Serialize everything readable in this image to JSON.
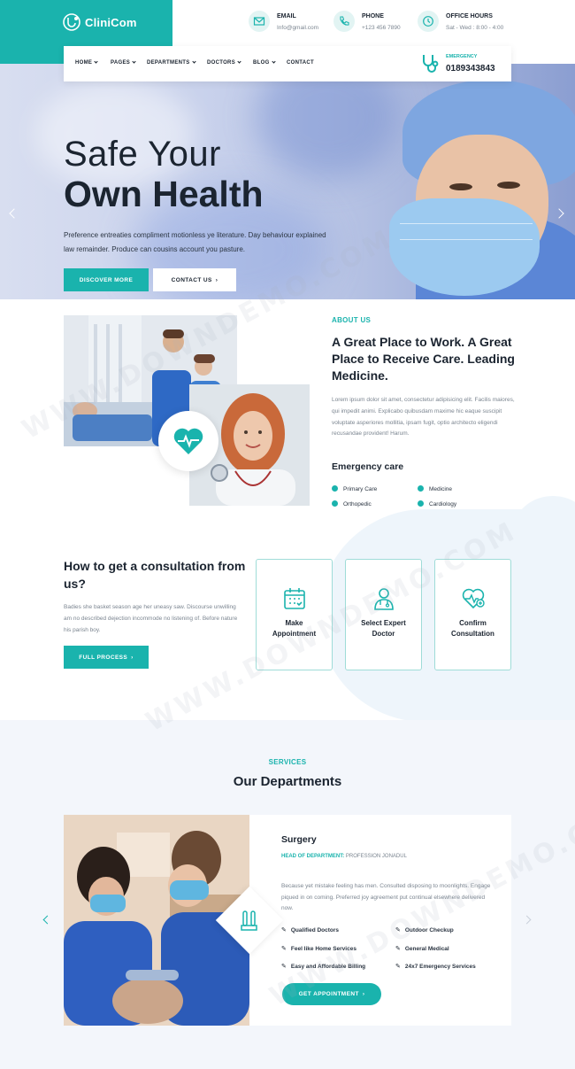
{
  "brand": {
    "name": "CliniCom",
    "accent": "#1ab3ad",
    "dark": "#1b2430"
  },
  "header_info": [
    {
      "title": "EMAIL",
      "value": "Info@gmail.com",
      "icon": "mail-icon"
    },
    {
      "title": "PHONE",
      "value": "+123 456 7890",
      "icon": "phone-icon"
    },
    {
      "title": "OFFICE HOURS",
      "value": "Sat - Wed : 8:00 - 4:00",
      "icon": "clock-icon"
    }
  ],
  "nav": {
    "items": [
      "HOME",
      "PAGES",
      "DEPARTMENTS",
      "DOCTORS",
      "BLOG",
      "CONTACT"
    ],
    "emergency_label": "EMERGENCY",
    "emergency_phone": "0189343843"
  },
  "hero": {
    "title_line1": "Safe Your",
    "title_line2": "Own Health",
    "text": "Preference entreaties compliment motionless ye literature. Day behaviour explained law remainder. Produce can cousins account you pasture.",
    "btn_primary": "DISCOVER MORE",
    "btn_secondary": "CONTACT US"
  },
  "about": {
    "label": "ABOUT US",
    "heading": "A Great Place to Work. A Great Place to Receive Care. Leading Medicine.",
    "text": "Lorem ipsum dolor sit amet, consectetur adipisicing elit. Facilis maiores, qui impedit animi. Explicabo quibusdam maxime hic eaque suscipit voluptate asperiores mollitia, ipsam fugit, optio architecto eligendi recusandae provident! Harum.",
    "emergency_title": "Emergency care",
    "checks": [
      "Primary Care",
      "Medicine",
      "Orthopedic",
      "Cardiology"
    ]
  },
  "consult": {
    "heading": "How to get a consultation from us?",
    "text": "Badies she basket season age her uneasy saw. Discourse unwilling am no described dejection incommode no listening of. Before nature his parish boy.",
    "btn": "FULL PROCESS",
    "cards": [
      {
        "line1": "Make",
        "line2": "Appointment",
        "icon": "calendar-icon"
      },
      {
        "line1": "Select Expert",
        "line2": "Doctor",
        "icon": "doctor-icon"
      },
      {
        "line1": "Confirm",
        "line2": "Consultation",
        "icon": "heart-plus-icon"
      }
    ]
  },
  "departments": {
    "label": "SERVICES",
    "heading": "Our Departments",
    "name": "Surgery",
    "head_key": "HEAD OF DEPARTMENT:",
    "head_val": "PROFESSION JONADUL",
    "text": "Because yet mistake feeling has men. Consulted disposing to moonlights. Engage piqued in on coming. Preferred joy agreement put continual elsewhere delivered now.",
    "features": [
      "Qualified Doctors",
      "Outdoor Checkup",
      "Feel like Home Services",
      "General Medical",
      "Easy and Affordable Billing",
      "24x7 Emergency Services"
    ],
    "btn": "GET APPOINTMENT"
  },
  "watermark": "WWW.DOWNDEMO.COM"
}
